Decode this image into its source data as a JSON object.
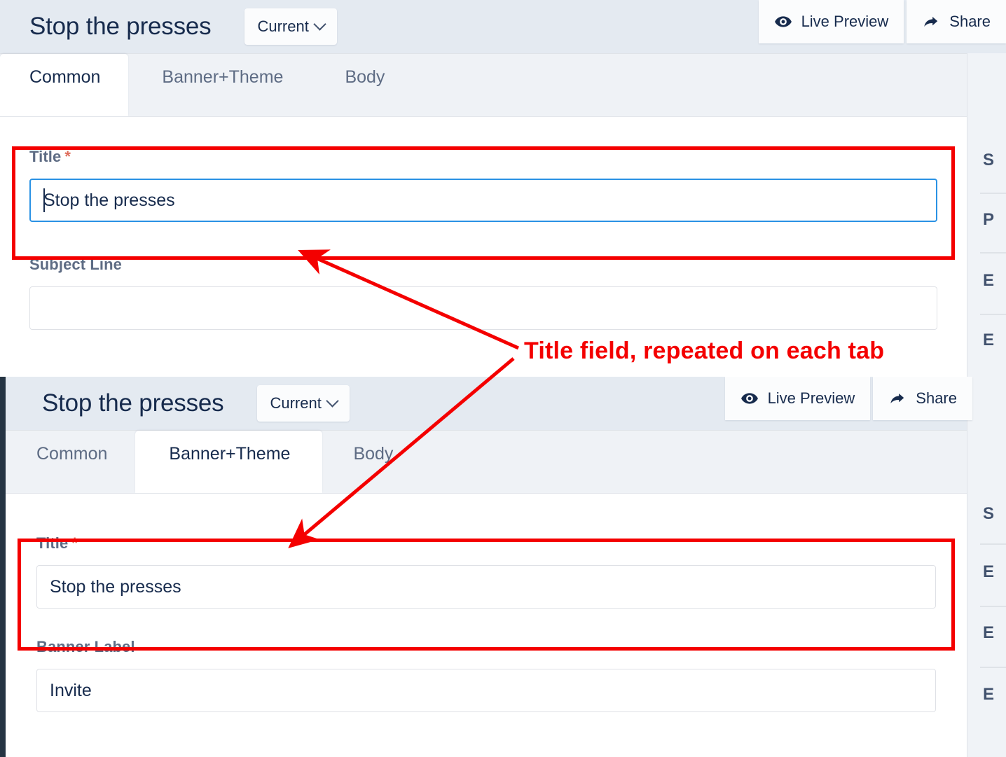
{
  "panels": [
    {
      "header": {
        "title": "Stop the presses",
        "version_chip": "Current",
        "version_chip_icon": "chevron-down-icon",
        "actions": [
          {
            "label": "Live Preview",
            "icon": "eye-icon"
          },
          {
            "label": "Share",
            "icon": "share-arrow-icon"
          }
        ]
      },
      "tabs": [
        {
          "label": "Common",
          "active": true
        },
        {
          "label": "Banner+Theme",
          "active": false
        },
        {
          "label": "Body",
          "active": false
        }
      ],
      "fields": [
        {
          "label": "Title",
          "required": true,
          "value": "Stop the presses",
          "placeholder": "",
          "focused": true
        },
        {
          "label": "Subject Line",
          "required": false,
          "value": "",
          "placeholder": "",
          "focused": false
        }
      ],
      "right_rail": [
        "S",
        "P",
        "E",
        "E"
      ]
    },
    {
      "header": {
        "title": "Stop the presses",
        "version_chip": "Current",
        "version_chip_icon": "chevron-down-icon",
        "actions": [
          {
            "label": "Live Preview",
            "icon": "eye-icon"
          },
          {
            "label": "Share",
            "icon": "share-arrow-icon"
          }
        ]
      },
      "tabs": [
        {
          "label": "Common",
          "active": false
        },
        {
          "label": "Banner+Theme",
          "active": true
        },
        {
          "label": "Body",
          "active": false
        }
      ],
      "fields": [
        {
          "label": "Title",
          "required": true,
          "value": "Stop the presses",
          "placeholder": "",
          "focused": false
        },
        {
          "label": "Banner Label",
          "required": false,
          "value": "Invite",
          "placeholder": "",
          "focused": false
        }
      ],
      "right_rail": [
        "S",
        "E",
        "E",
        "E"
      ]
    }
  ],
  "annotation": {
    "text": "Title field, repeated on each tab",
    "color": "#f40000"
  },
  "colors": {
    "annotation_red": "#f40000",
    "header_bg": "#e4eaf1",
    "tabstrip_bg": "#eff2f6",
    "active_tab_bg": "#ffffff",
    "label_text": "#5e6c84",
    "title_text": "#172b4d",
    "focus_border": "#2a92e4",
    "required_asterisk": "#de6b5a",
    "left_rail": "#253443",
    "right_rail_bg": "#f0f3f7"
  }
}
